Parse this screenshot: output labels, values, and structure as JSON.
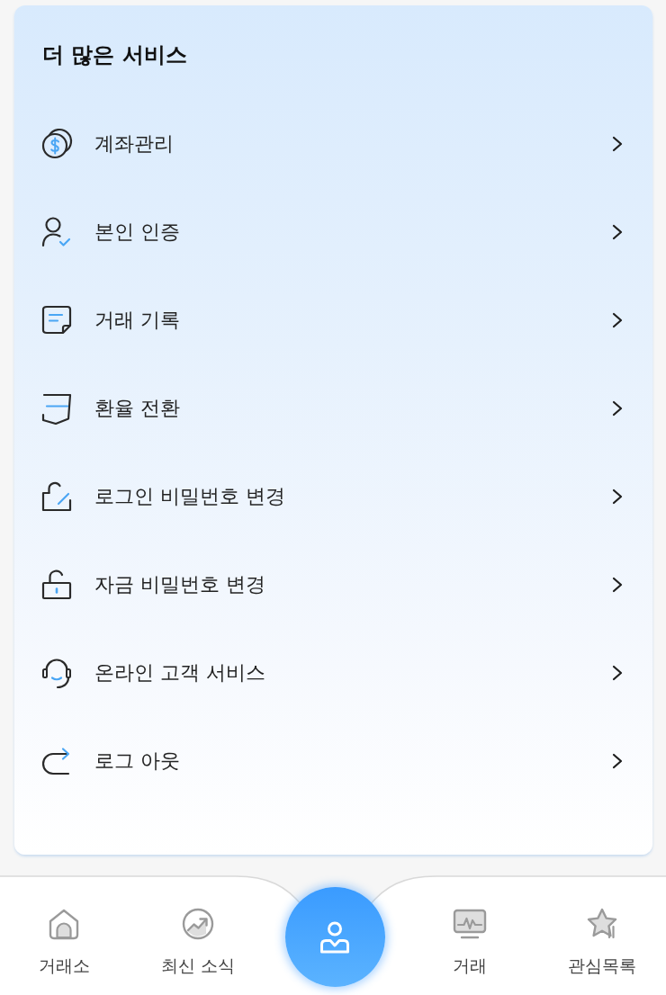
{
  "services": {
    "title": "더 많은 서비스",
    "items": [
      {
        "label": "계좌관리"
      },
      {
        "label": "본인 인증"
      },
      {
        "label": "거래 기록"
      },
      {
        "label": "환율 전환"
      },
      {
        "label": "로그인 비밀번호 변경"
      },
      {
        "label": "자금 비밀번호 변경"
      },
      {
        "label": "온라인 고객 서비스"
      },
      {
        "label": "로그 아웃"
      }
    ]
  },
  "tab_bar": {
    "items": [
      {
        "kind": "tab",
        "label": "거래소",
        "selected": false
      },
      {
        "kind": "tab",
        "label": "최신 소식",
        "selected": false
      },
      {
        "kind": "center",
        "selected": true
      },
      {
        "kind": "tab",
        "label": "거래",
        "selected": false
      },
      {
        "kind": "tab",
        "label": "관심목록",
        "selected": false
      }
    ]
  }
}
